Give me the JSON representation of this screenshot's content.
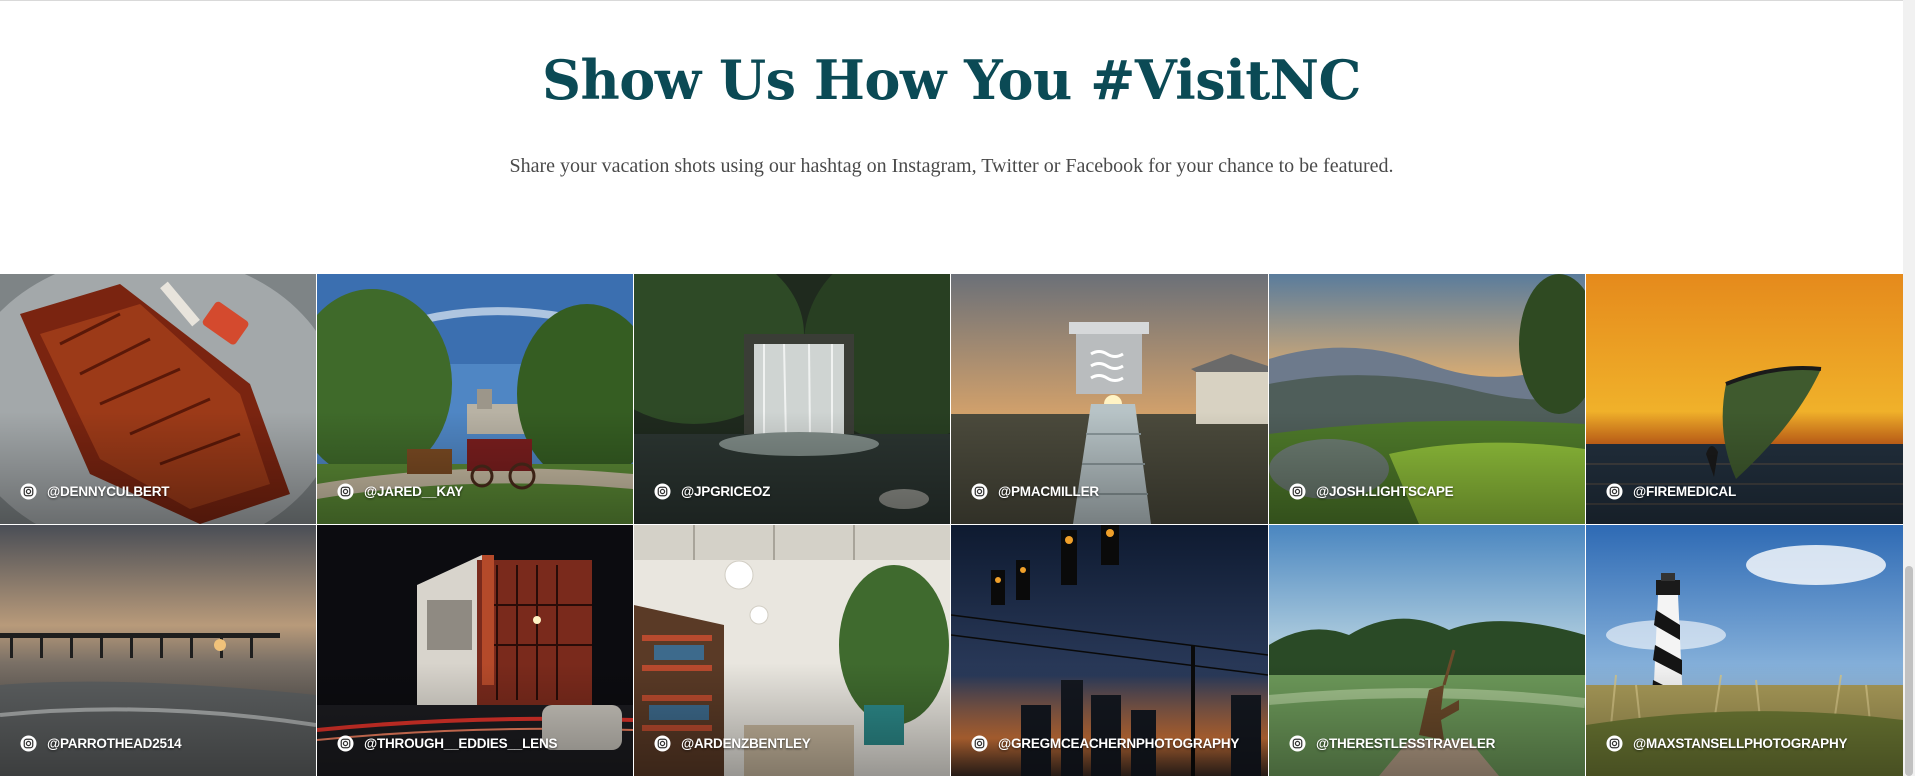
{
  "section": {
    "title": "Show Us How You #VisitNC",
    "subtitle": "Share your vacation shots using our hashtag on Instagram, Twitter or Facebook for your chance to be featured."
  },
  "colors": {
    "title": "#0b4a55",
    "subtitle": "#4a4a4a",
    "caption": "#ffffff"
  },
  "icon": "instagram-icon",
  "gallery": [
    {
      "handle": "@DENNYCULBERT",
      "subject": "ribs"
    },
    {
      "handle": "@JARED__KAY",
      "subject": "carriage"
    },
    {
      "handle": "@JPGRICEOZ",
      "subject": "waterfall"
    },
    {
      "handle": "@PMACMILLER",
      "subject": "lifeguard-stand"
    },
    {
      "handle": "@JOSH.LIGHTSCAPE",
      "subject": "mountain-sunset"
    },
    {
      "handle": "@FIREMEDICAL",
      "subject": "kitesurf"
    },
    {
      "handle": "@PARROTHEAD2514",
      "subject": "pier"
    },
    {
      "handle": "@THROUGH__EDDIES__LENS",
      "subject": "theater"
    },
    {
      "handle": "@ARDENZBENTLEY",
      "subject": "bookstore"
    },
    {
      "handle": "@GREGMCEACHERNPHOTOGRAPHY",
      "subject": "city-night"
    },
    {
      "handle": "@THERESTLESSTRAVELER",
      "subject": "golf-statue"
    },
    {
      "handle": "@MAXSTANSELLPHOTOGRAPHY",
      "subject": "lighthouse"
    }
  ]
}
